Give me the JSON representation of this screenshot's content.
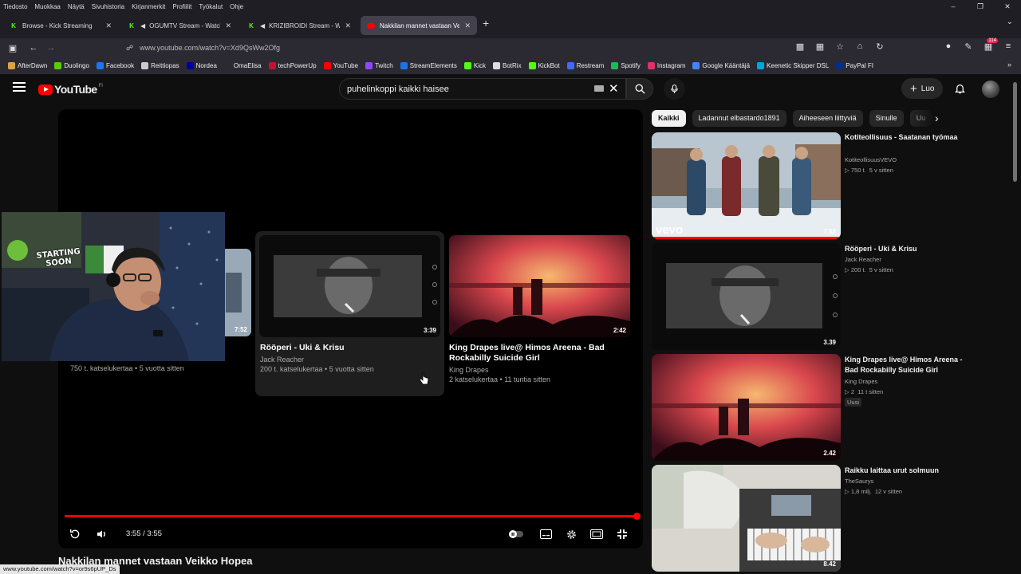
{
  "menubar": [
    "Tiedosto",
    "Muokkaa",
    "Näytä",
    "Sivuhistoria",
    "Kirjanmerkit",
    "Profiilit",
    "Työkalut",
    "Ohje"
  ],
  "tabs": [
    {
      "title": "Browse - Kick Streaming",
      "icon": "kick-icon"
    },
    {
      "title": "OGUMTV Stream - Watch L",
      "icon": "kick-icon"
    },
    {
      "title": "KRIZIBROIDI Stream - Watc",
      "icon": "kick-icon"
    },
    {
      "title": "Nakkilan mannet vastaan Veik",
      "icon": "youtube-icon"
    }
  ],
  "url": "www.youtube.com/watch?v=Xd9QsWw2Ofg",
  "extensions_badge": "114",
  "bookmarks": [
    {
      "label": "AfterDawn",
      "color": "#d9a441"
    },
    {
      "label": "Duolingo",
      "color": "#58cc02"
    },
    {
      "label": "Facebook",
      "color": "#1877f2"
    },
    {
      "label": "Reittiopas",
      "color": "#cccccc"
    },
    {
      "label": "Nordea",
      "color": "#0000a0"
    },
    {
      "label": "OmaElisa",
      "color": "#2b2a33"
    },
    {
      "label": "techPowerUp",
      "color": "#c8102e"
    },
    {
      "label": "YouTube",
      "color": "#ff0000"
    },
    {
      "label": "Twitch",
      "color": "#9146ff"
    },
    {
      "label": "StreamElements",
      "color": "#1a73e8"
    },
    {
      "label": "Kick",
      "color": "#53fc18"
    },
    {
      "label": "BotRix",
      "color": "#dddddd"
    },
    {
      "label": "KickBot",
      "color": "#53fc18"
    },
    {
      "label": "Restream",
      "color": "#3d6bff"
    },
    {
      "label": "Spotify",
      "color": "#1db954"
    },
    {
      "label": "Instagram",
      "color": "#e1306c"
    },
    {
      "label": "Google Kääntäjä",
      "color": "#4285f4"
    },
    {
      "label": "Keenetic Skipper DSL",
      "color": "#00a6e0"
    },
    {
      "label": "PayPal FI",
      "color": "#003087"
    }
  ],
  "youtube": {
    "logo_text": "YouTube",
    "country_code": "FI",
    "search_query": "puhelinkoppi kaikki haisee",
    "create_label": "Luo"
  },
  "player": {
    "time": "3:55 / 3:55",
    "progress": 1.0,
    "endcards": [
      {
        "duration": "7:52",
        "views": "750 t. katselukertaa • 5 vuotta sitten"
      },
      {
        "title": "Rööperi - Uki & Krisu",
        "channel": "Jack Reacher",
        "views": "200 t. katselukertaa • 5 vuotta sitten",
        "duration": "3:39"
      },
      {
        "title": "King Drapes live@ Himos Areena - Bad Rockabilly Suicide Girl",
        "channel": "King Drapes",
        "views": "2 katselukertaa • 11 tuntia sitten",
        "duration": "2:42"
      }
    ],
    "webcam_sign": "STARTING SOON"
  },
  "video_title": "Nakkilan mannet vastaan Veikko Hopea",
  "status_url": "www.youtube.com/watch?v=or9s6pUP_Ds",
  "chips": [
    "Kaikki",
    "Ladannut elbastardo1891",
    "Aiheeseen liittyviä",
    "Sinulle",
    "Uu"
  ],
  "recommendations": [
    {
      "title": "Kotiteollisuus - Saatanan työmaa",
      "channel": "KotiteollisuusVEVO",
      "views": "▷ 750 t.",
      "age": "5 v sitten",
      "duration": "7.52",
      "badge": "vevo"
    },
    {
      "title": "Rööperi - Uki & Krisu",
      "channel": "Jack Reacher",
      "views": "▷ 200 t.",
      "age": "5 v sitten",
      "duration": "3.39"
    },
    {
      "title": "King Drapes live@ Himos Areena - Bad Rockabilly Suicide  Girl",
      "channel": "King Drapes",
      "views": "▷ 2",
      "age": "11 t sitten",
      "duration": "2.42",
      "new_badge": "Uusi"
    },
    {
      "title": "Raikku laittaa urut solmuun",
      "channel": "TheSaurys",
      "views": "▷ 1,8 milj.",
      "age": "12 v sitten",
      "duration": "8.42"
    }
  ]
}
